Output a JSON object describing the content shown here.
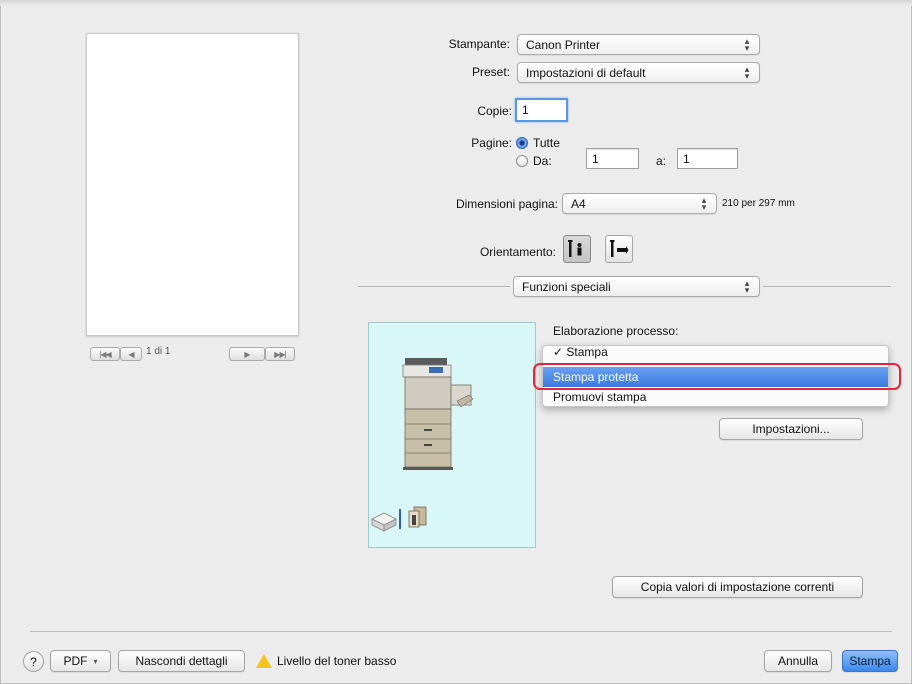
{
  "preview": {
    "page_counter": "1 di 1",
    "nav": {
      "first": "|◀◀",
      "prev": "◀",
      "next": "▶",
      "last": "▶▶|"
    }
  },
  "printer": {
    "label": "Stampante:",
    "value": "Canon Printer"
  },
  "preset": {
    "label": "Preset:",
    "value": "Impostazioni di default"
  },
  "copies": {
    "label": "Copie:",
    "value": "1"
  },
  "pages": {
    "label": "Pagine:",
    "all_label": "Tutte",
    "from_label": "Da:",
    "from_value": "1",
    "to_label": "a:",
    "to_value": "1"
  },
  "paper_size": {
    "label": "Dimensioni pagina:",
    "value": "A4",
    "dimensions": "210 per 297 mm"
  },
  "orientation": {
    "label": "Orientamento:"
  },
  "section_popup": {
    "value": "Funzioni speciali"
  },
  "job_processing": {
    "label": "Elaborazione processo:",
    "menu_items": [
      "✓ Stampa",
      "Stampa protetta",
      "Promuovi stampa"
    ],
    "highlighted_index": 1
  },
  "settings_button": "Impostazioni...",
  "copy_settings_button": "Copia valori di impostazione correnti",
  "footer": {
    "help": "?",
    "pdf": "PDF",
    "hide_details": "Nascondi dettagli",
    "warning_text": "Livello del toner basso",
    "cancel": "Annulla",
    "print": "Stampa"
  },
  "colors": {
    "accent": "#3a7ae0",
    "highlight_ring": "#e2263c",
    "preview_bg": "#d9f7f7",
    "warning": "#f3c21b"
  }
}
